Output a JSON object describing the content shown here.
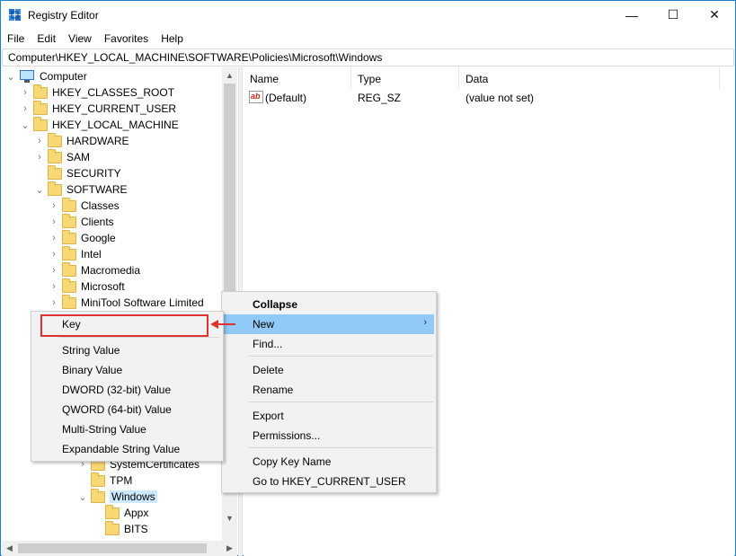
{
  "window": {
    "title": "Registry Editor",
    "controls": {
      "minimize": "—",
      "maximize": "☐",
      "close": "✕"
    }
  },
  "menubar": [
    "File",
    "Edit",
    "View",
    "Favorites",
    "Help"
  ],
  "address": "Computer\\HKEY_LOCAL_MACHINE\\SOFTWARE\\Policies\\Microsoft\\Windows",
  "tree": {
    "root": "Computer",
    "items": [
      {
        "label": "HKEY_CLASSES_ROOT",
        "expander": "›"
      },
      {
        "label": "HKEY_CURRENT_USER",
        "expander": "›"
      },
      {
        "label": "HKEY_LOCAL_MACHINE",
        "expander": "⌄"
      },
      {
        "label": "HARDWARE",
        "expander": "›"
      },
      {
        "label": "SAM",
        "expander": "›"
      },
      {
        "label": "SECURITY",
        "expander": ""
      },
      {
        "label": "SOFTWARE",
        "expander": "⌄"
      },
      {
        "label": "Classes",
        "expander": "›"
      },
      {
        "label": "Clients",
        "expander": "›"
      },
      {
        "label": "Google",
        "expander": "›"
      },
      {
        "label": "Intel",
        "expander": "›"
      },
      {
        "label": "Macromedia",
        "expander": "›"
      },
      {
        "label": "Microsoft",
        "expander": "›"
      },
      {
        "label": "MiniTool Software Limited",
        "expander": "›"
      },
      {
        "label": "SystemCertificates",
        "expander": "›"
      },
      {
        "label": "TPM",
        "expander": ""
      },
      {
        "label": "Windows",
        "expander": "⌄"
      },
      {
        "label": "Appx",
        "expander": ""
      },
      {
        "label": "BITS",
        "expander": ""
      }
    ],
    "root_expander": "⌄"
  },
  "scroll": {
    "up": "▲",
    "down": "▼",
    "left": "◀",
    "right": "▶"
  },
  "list": {
    "columns": [
      "Name",
      "Type",
      "Data"
    ],
    "rows": [
      {
        "icon": "ab",
        "name": "(Default)",
        "type": "REG_SZ",
        "data": "(value not set)"
      }
    ]
  },
  "context_menu": {
    "items": [
      "Collapse",
      "New",
      "Find...",
      "Delete",
      "Rename",
      "Export",
      "Permissions...",
      "Copy Key Name",
      "Go to HKEY_CURRENT_USER"
    ],
    "submenu_arrow": "›",
    "hover_index": 1
  },
  "new_submenu": {
    "items": [
      "Key",
      "String Value",
      "Binary Value",
      "DWORD (32-bit) Value",
      "QWORD (64-bit) Value",
      "Multi-String Value",
      "Expandable String Value"
    ]
  },
  "colors": {
    "accent": "#1883d7",
    "hover": "#91c9f7",
    "highlight": "#e0332f",
    "folder": "#f8d775"
  }
}
